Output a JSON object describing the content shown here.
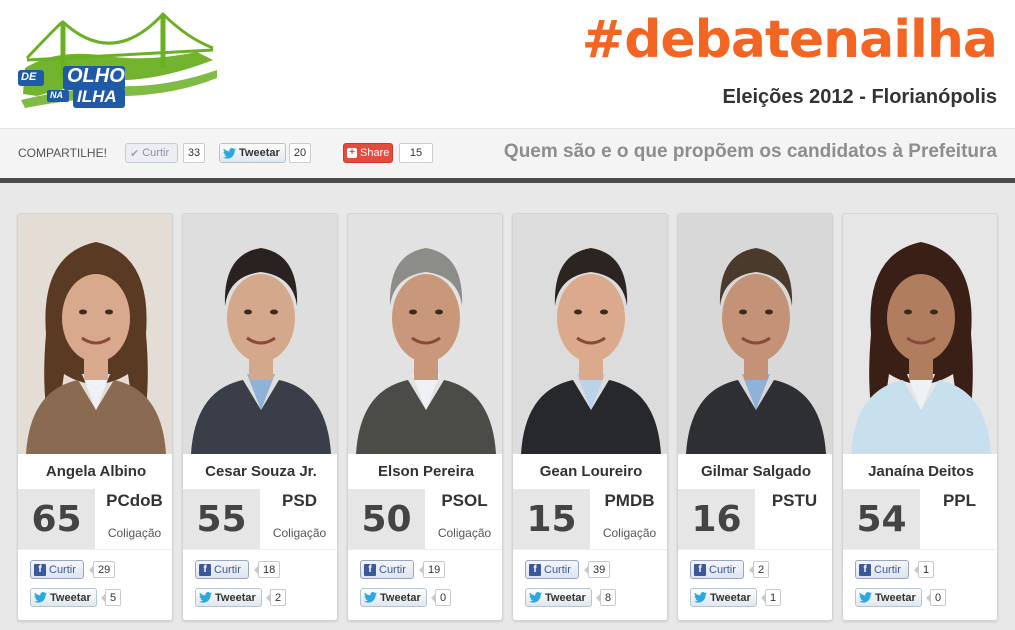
{
  "header": {
    "logo": {
      "line1": "DE",
      "line2": "OLHO",
      "line3": "NA",
      "line4": "ILHA",
      "icon": "bridge-logo"
    },
    "hashtag": "#debatenailha",
    "election": "Eleições 2012 - Florianópolis"
  },
  "sharebar": {
    "label": "COMPARTILHE!",
    "curtir_label": "Curtir",
    "curtir_count": "33",
    "tweet_label": "Tweetar",
    "tweet_count": "20",
    "share_label": "Share",
    "share_count": "15",
    "subtitle": "Quem são e o que propõem os candidatos à Prefeitura"
  },
  "labels": {
    "coalition": "Coligação",
    "curtir": "Curtir",
    "tweetar": "Tweetar"
  },
  "colors": {
    "accent": "#f26522",
    "logo_green": "#6ab023",
    "logo_blue": "#1f5aa6",
    "facebook": "#3b5998",
    "twitter": "#2aa9e0"
  },
  "candidates": [
    {
      "name": "Angela Albino",
      "number": "65",
      "party": "PCdoB",
      "coalition": "Coligação",
      "likes": "29",
      "tweets": "5",
      "skin": "#d8a98c",
      "hair": "#5a3a22",
      "clothing": "#8a6b52",
      "background": "#e3ddd6"
    },
    {
      "name": "Cesar Souza Jr.",
      "number": "55",
      "party": "PSD",
      "coalition": "Coligação",
      "likes": "18",
      "tweets": "2",
      "skin": "#d4a88a",
      "hair": "#2a2220",
      "clothing": "#3a3e48",
      "background": "#dedede"
    },
    {
      "name": "Elson Pereira",
      "number": "50",
      "party": "PSOL",
      "coalition": "Coligação",
      "likes": "19",
      "tweets": "0",
      "skin": "#c9987a",
      "hair": "#8c8c88",
      "clothing": "#4b4b48",
      "background": "#e2e2e2"
    },
    {
      "name": "Gean Loureiro",
      "number": "15",
      "party": "PMDB",
      "coalition": "Coligação",
      "likes": "39",
      "tweets": "8",
      "skin": "#dba98b",
      "hair": "#2c2420",
      "clothing": "#26282c",
      "background": "#dcdcdc"
    },
    {
      "name": "Gilmar Salgado",
      "number": "16",
      "party": "PSTU",
      "coalition": "",
      "likes": "2",
      "tweets": "1",
      "skin": "#c49276",
      "hair": "#4a3a2c",
      "clothing": "#2e2f33",
      "background": "#d8d8d8"
    },
    {
      "name": "Janaína Deitos",
      "number": "54",
      "party": "PPL",
      "coalition": "",
      "likes": "1",
      "tweets": "0",
      "skin": "#b07d5f",
      "hair": "#3a1f16",
      "clothing": "#c8e0ee",
      "background": "#e6e6e6"
    }
  ]
}
